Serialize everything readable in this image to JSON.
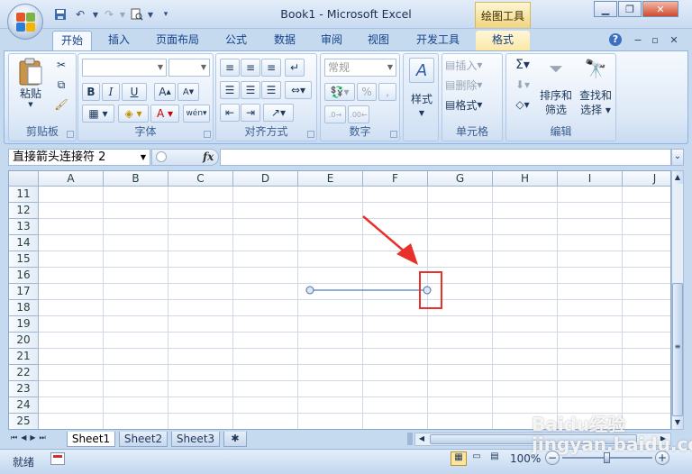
{
  "titlebar": {
    "title": "Book1 - Microsoft Excel",
    "context_tab_label": "绘图工具"
  },
  "tabs": [
    {
      "label": "开始",
      "active": true
    },
    {
      "label": "插入"
    },
    {
      "label": "页面布局"
    },
    {
      "label": "公式"
    },
    {
      "label": "数据"
    },
    {
      "label": "审阅"
    },
    {
      "label": "视图"
    },
    {
      "label": "开发工具"
    },
    {
      "label": "格式"
    }
  ],
  "ribbon": {
    "clipboard": {
      "label": "剪贴板",
      "paste": "粘贴"
    },
    "font": {
      "label": "字体",
      "bold": "B",
      "italic": "I",
      "underline": "U"
    },
    "alignment": {
      "label": "对齐方式"
    },
    "number": {
      "label": "数字",
      "format": "常规",
      "percent": "%",
      "comma": ","
    },
    "styles": {
      "label": "样式"
    },
    "cells": {
      "label": "单元格",
      "insert": "插入",
      "delete": "删除",
      "format": "格式"
    },
    "editing": {
      "label": "编辑",
      "sort": "排序和",
      "sort2": "筛选",
      "find": "查找和",
      "find2": "选择"
    }
  },
  "formula_bar": {
    "name_box": "直接箭头连接符 2",
    "fx": "fx"
  },
  "grid": {
    "columns": [
      "A",
      "B",
      "C",
      "D",
      "E",
      "F",
      "G",
      "H",
      "I",
      "J"
    ],
    "rows": [
      "11",
      "12",
      "13",
      "14",
      "15",
      "16",
      "17",
      "18",
      "19",
      "20",
      "21",
      "22",
      "23",
      "24",
      "25"
    ]
  },
  "sheets": [
    {
      "label": "Sheet1",
      "active": true
    },
    {
      "label": "Sheet2"
    },
    {
      "label": "Sheet3"
    }
  ],
  "status": {
    "ready": "就绪",
    "zoom": "100%"
  },
  "watermark": "Baidu经验 jingyan.baidu.com",
  "colors": {
    "annotation": "#e8312a",
    "connector": "#4a7ebb"
  }
}
